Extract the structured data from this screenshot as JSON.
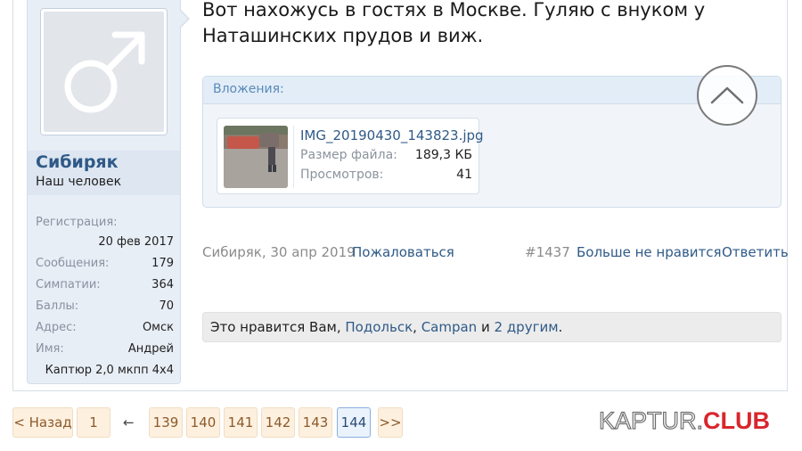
{
  "user": {
    "name": "Сибиряк",
    "title": "Наш человек",
    "registration_label": "Регистрация:",
    "registration_value": "20 фев 2017",
    "stats": [
      {
        "label": "Сообщения:",
        "value": "179"
      },
      {
        "label": "Симпатии:",
        "value": "364"
      },
      {
        "label": "Баллы:",
        "value": "70"
      },
      {
        "label": "Адрес:",
        "value": "Омск"
      },
      {
        "label": "Имя:",
        "value": "Андрей"
      }
    ],
    "car": "Каптюр 2,0 мкпп 4х4"
  },
  "message": {
    "line1": "Вот нахожусь в гостях в Москве. Гуляю с внуком у",
    "line2": "Наташинских прудов и виж."
  },
  "attachments": {
    "header": "Вложения:",
    "file": {
      "name": "IMG_20190430_143823.jpg",
      "size_label": "Размер файла:",
      "size_value": "189,3 КБ",
      "views_label": "Просмотров:",
      "views_value": "41"
    }
  },
  "post_meta": {
    "author_date": "Сибиряк, 30 апр 2019",
    "report": "Пожаловаться",
    "number": "#1437",
    "unlike": "Больше не нравится",
    "reply": "Ответить"
  },
  "likes": {
    "prefix": "Это нравится Вам, ",
    "user1": "Подольск",
    "comma": ", ",
    "user2": "Campan",
    "and": " и ",
    "others": "2 другим",
    "dot": "."
  },
  "pagination": {
    "back": "< Назад",
    "first": "1",
    "ellipsis": "←",
    "pages": [
      "139",
      "140",
      "141",
      "142",
      "143"
    ],
    "current": "144",
    "next": ">>"
  },
  "logo": {
    "part1": "KAPTUR.",
    "part2": "CLUB"
  },
  "colors": {
    "link": "#2f5a87",
    "accent_red": "#d8262c",
    "page_bg": "#fdf0df"
  }
}
